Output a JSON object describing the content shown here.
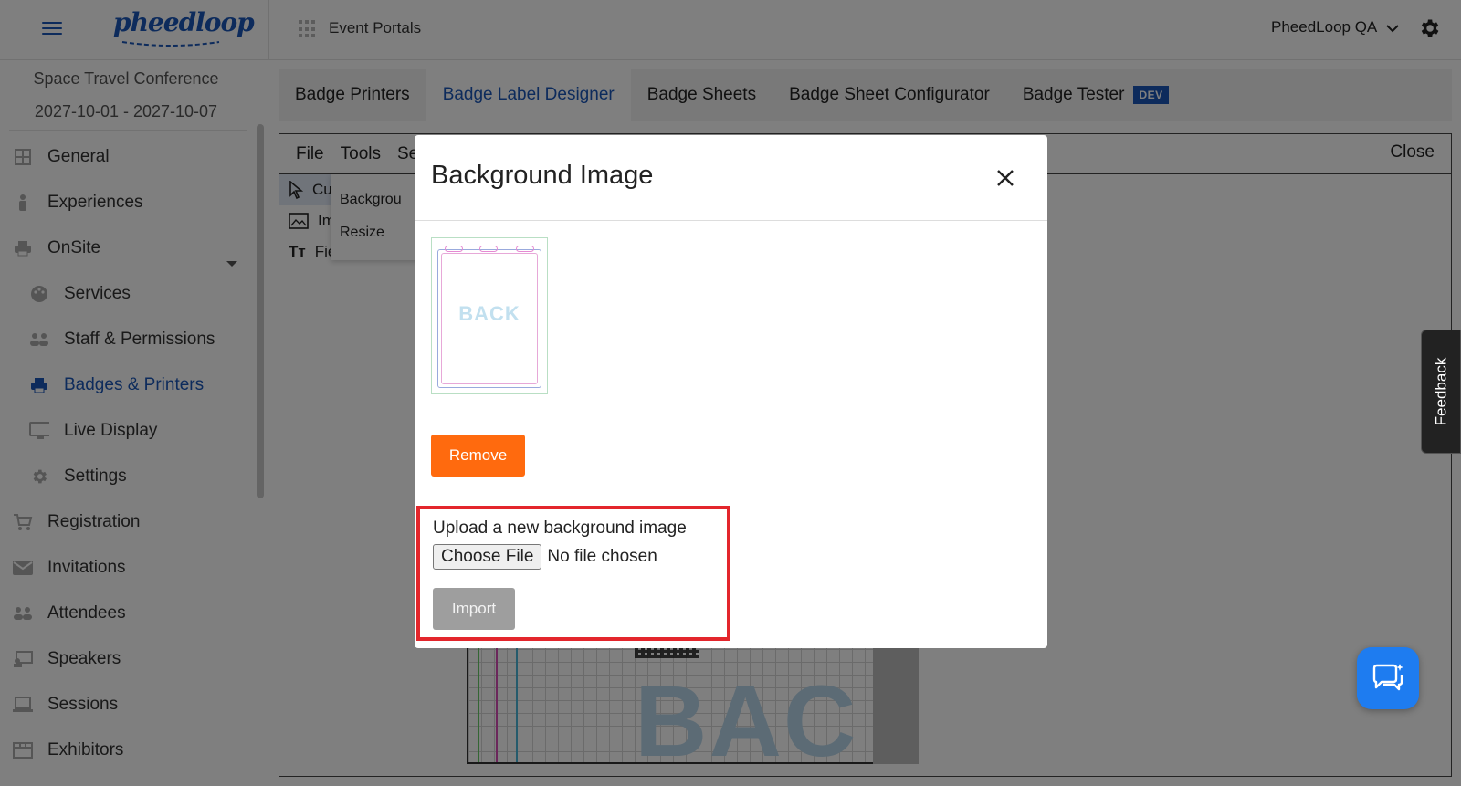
{
  "header": {
    "logo_text": "pheedloop",
    "portals_label": "Event Portals",
    "org_name": "PheedLoop QA"
  },
  "sidebar": {
    "event_name": "Space Travel Conference",
    "event_dates": "2027-10-01 - 2027-10-07",
    "items": [
      {
        "label": "General",
        "icon": "grid-icon"
      },
      {
        "label": "Experiences",
        "icon": "person-icon"
      },
      {
        "label": "OnSite",
        "icon": "printer-icon"
      },
      {
        "label": "Services",
        "icon": "palette-icon"
      },
      {
        "label": "Staff & Permissions",
        "icon": "people-icon"
      },
      {
        "label": "Badges & Printers",
        "icon": "printer-icon"
      },
      {
        "label": "Live Display",
        "icon": "monitor-icon"
      },
      {
        "label": "Settings",
        "icon": "gear-icon"
      },
      {
        "label": "Registration",
        "icon": "cart-icon"
      },
      {
        "label": "Invitations",
        "icon": "mail-icon"
      },
      {
        "label": "Attendees",
        "icon": "people-icon"
      },
      {
        "label": "Speakers",
        "icon": "presenter-icon"
      },
      {
        "label": "Sessions",
        "icon": "laptop-icon"
      },
      {
        "label": "Exhibitors",
        "icon": "booth-icon"
      }
    ],
    "active_item": "Badges & Printers"
  },
  "tabs": {
    "items": [
      "Badge Printers",
      "Badge Label Designer",
      "Badge Sheets",
      "Badge Sheet Configurator",
      "Badge Tester"
    ],
    "active": "Badge Label Designer",
    "dev_badge": "DEV"
  },
  "designer": {
    "menu": [
      "File",
      "Tools",
      "Se"
    ],
    "close_label": "Close",
    "tools": [
      "Cu",
      "Im",
      "Field Name"
    ],
    "submenu": [
      "Backgrou",
      "Resize"
    ],
    "canvas_text": "BAC"
  },
  "modal": {
    "title": "Background Image",
    "preview_text": "BACK",
    "remove_label": "Remove",
    "upload_label": "Upload a new background image",
    "choose_file_label": "Choose File",
    "no_file_text": "No file chosen",
    "import_label": "Import"
  },
  "feedback_label": "Feedback",
  "colors": {
    "brand_blue": "#1a56b8",
    "remove_orange": "#ff6a0e",
    "highlight_red": "#e3262c",
    "chat_blue": "#1e7cf0"
  }
}
